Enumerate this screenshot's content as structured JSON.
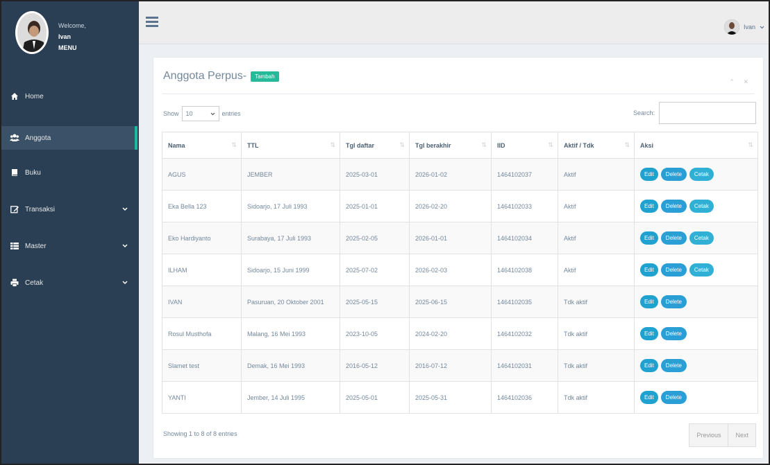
{
  "sidebar": {
    "welcome": "Welcome,",
    "username": "Ivan",
    "menu_title": "MENU",
    "items": [
      {
        "label": "Home",
        "icon": "home-icon"
      },
      {
        "label": "Anggota",
        "icon": "users-icon"
      },
      {
        "label": "Buku",
        "icon": "book-icon"
      },
      {
        "label": "Transaksi",
        "icon": "edit-icon"
      },
      {
        "label": "Master",
        "icon": "table-icon"
      },
      {
        "label": "Cetak",
        "icon": "print-icon"
      }
    ]
  },
  "topbar": {
    "username": "Ivan"
  },
  "panel": {
    "title": "Anggota Perpus-",
    "add_button": "Tambah",
    "tools": "⌃ ✕"
  },
  "table_controls": {
    "show": "Show",
    "page_length": "10",
    "entries": "entries",
    "search_label": "Search:"
  },
  "table": {
    "columns": [
      "Nama",
      "TTL",
      "Tgl daftar",
      "Tgl berakhir",
      "IID",
      "Aktif / Tdk",
      "Aksi"
    ],
    "rows": [
      {
        "nama": "AGUS",
        "ttl": "JEMBER",
        "tgl_daftar": "2025-03-01",
        "tgl_berakhir": "2026-01-02",
        "iid": "1464102037",
        "status": "Aktif",
        "actions": [
          "Edit",
          "Delete",
          "Cetak"
        ]
      },
      {
        "nama": "Eka Bella 123",
        "ttl": "Sidoarjo, 17 Juli 1993",
        "tgl_daftar": "2025-01-01",
        "tgl_berakhir": "2026-02-20",
        "iid": "1464102033",
        "status": "Aktif",
        "actions": [
          "Edit",
          "Delete",
          "Cetak"
        ]
      },
      {
        "nama": "Eko Hardiyanto",
        "ttl": "Surabaya, 17 Juli 1993",
        "tgl_daftar": "2025-02-05",
        "tgl_berakhir": "2026-01-01",
        "iid": "1464102034",
        "status": "Aktif",
        "actions": [
          "Edit",
          "Delete",
          "Cetak"
        ]
      },
      {
        "nama": "ILHAM",
        "ttl": "Sidoarjo, 15 Juni 1999",
        "tgl_daftar": "2025-07-02",
        "tgl_berakhir": "2026-02-03",
        "iid": "1464102038",
        "status": "Aktif",
        "actions": [
          "Edit",
          "Delete",
          "Cetak"
        ]
      },
      {
        "nama": "IVAN",
        "ttl": "Pasuruan, 20 Oktober 2001",
        "tgl_daftar": "2025-05-15",
        "tgl_berakhir": "2025-06-15",
        "iid": "1464102035",
        "status": "Tdk aktif",
        "actions": [
          "Edit",
          "Delete"
        ]
      },
      {
        "nama": "Rosul Musthofa",
        "ttl": "Malang, 16 Mei 1993",
        "tgl_daftar": "2023-10-05",
        "tgl_berakhir": "2024-02-20",
        "iid": "1464102032",
        "status": "Tdk aktif",
        "actions": [
          "Edit",
          "Delete"
        ]
      },
      {
        "nama": "Slamet test",
        "ttl": "Demak, 16 Mei 1993",
        "tgl_daftar": "2016-05-12",
        "tgl_berakhir": "2016-07-12",
        "iid": "1464102031",
        "status": "Tdk aktif",
        "actions": [
          "Edit",
          "Delete"
        ]
      },
      {
        "nama": "YANTI",
        "ttl": "Jember, 14 Juli 1995",
        "tgl_daftar": "2025-05-01",
        "tgl_berakhir": "2025-05-31",
        "iid": "1464102036",
        "status": "Tdk aktif",
        "actions": [
          "Edit",
          "Delete"
        ]
      }
    ]
  },
  "footer": {
    "info": "Showing 1 to 8 of 8 entries",
    "previous": "Previous",
    "next": "Next"
  },
  "colors": {
    "sidebar_bg": "#2a3f54",
    "accent_green": "#26b99a",
    "button_blue": "#1fa2cf"
  }
}
